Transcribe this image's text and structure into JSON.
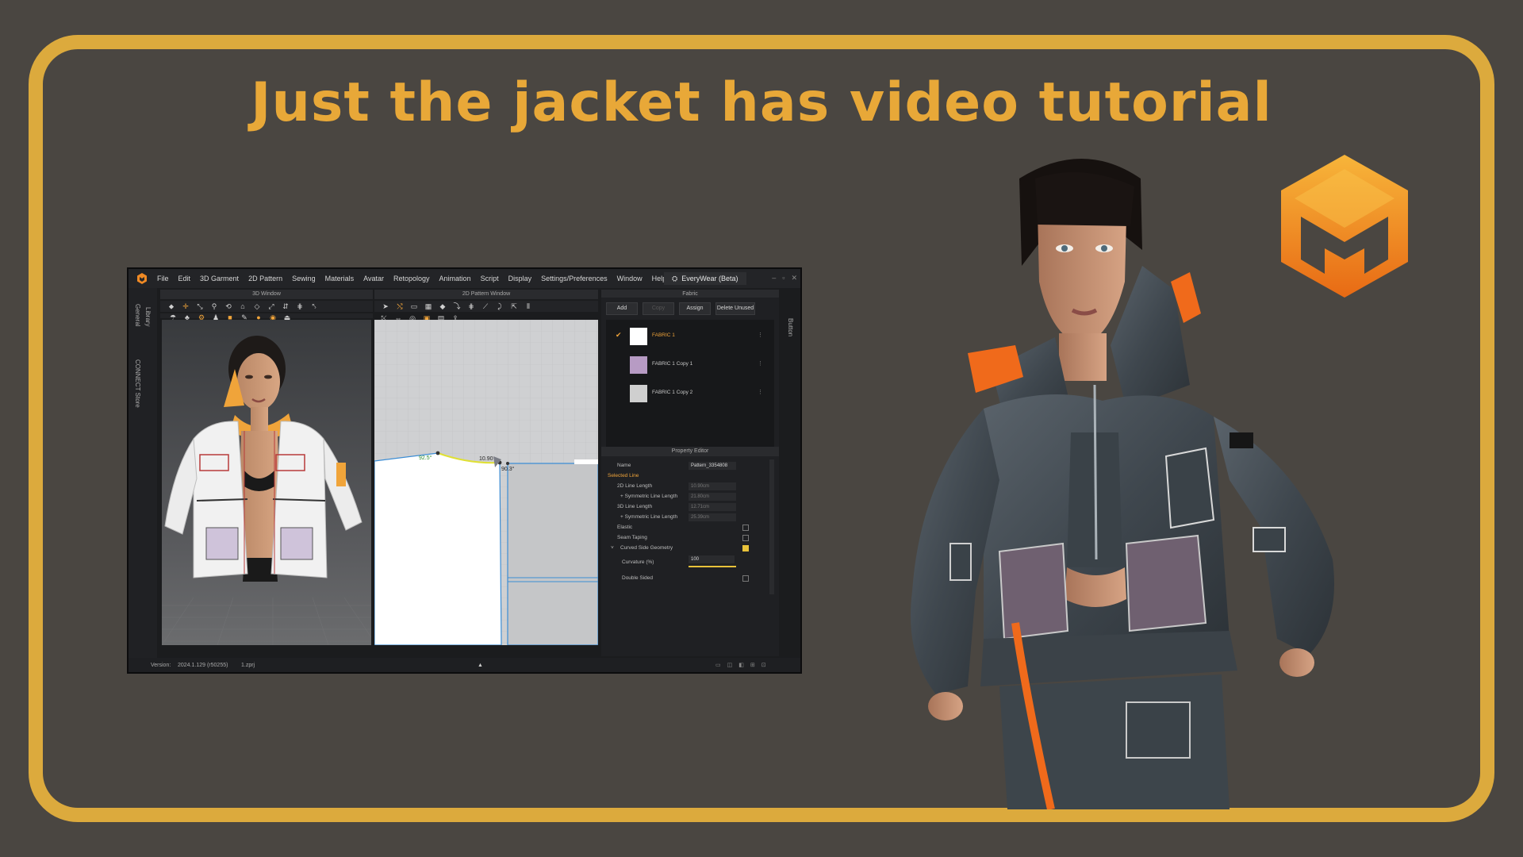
{
  "headline": "Just the jacket has video tutorial",
  "app": {
    "menu": [
      "File",
      "Edit",
      "3D Garment",
      "2D Pattern",
      "Sewing",
      "Materials",
      "Avatar",
      "Retopology",
      "Animation",
      "Script",
      "Display",
      "Settings/Preferences",
      "Window",
      "Help"
    ],
    "workspace": "EveryWear (Beta)",
    "side_tabs": [
      "Library",
      "General",
      "CONNECT Store"
    ],
    "right_tab": "Button",
    "panel_3d_title": "3D Window",
    "panel_2d_title": "2D Pattern Window",
    "fabric_panel_title": "Fabric",
    "fabric_buttons": {
      "add": "Add",
      "copy": "Copy",
      "assign": "Assign",
      "delete_unused": "Delete Unused"
    },
    "fabrics": [
      {
        "name": "FABRIC 1",
        "color": "#ffffff",
        "selected": true
      },
      {
        "name": "FABRIC 1 Copy 1",
        "color": "#b79bc4",
        "selected": false
      },
      {
        "name": "FABRIC 1 Copy 2",
        "color": "#cfcfcf",
        "selected": false
      }
    ],
    "property_editor_title": "Property Editor",
    "properties": {
      "name_label": "Name",
      "name_value": "Pattern_3354808",
      "selected_line": "Selected Line",
      "line_2d_label": "2D Line Length",
      "line_2d_value": "10.90cm",
      "sym_2d_label": "+ Symmetric Line Length",
      "sym_2d_value": "21.80cm",
      "line_3d_label": "3D Line Length",
      "line_3d_value": "12.71cm",
      "sym_3d_label": "+ Symmetric Line Length",
      "sym_3d_value": "25.39cm",
      "elastic_label": "Elastic",
      "seam_taping_label": "Seam Taping",
      "curved_label": "Curved Side Geometry",
      "curvature_label": "Curvature (%)",
      "curvature_value": "100",
      "double_sided_label": "Double Sided"
    },
    "pattern_labels": {
      "angle": "92.5°",
      "length": "10.90",
      "angle2": "90.3°"
    },
    "status": {
      "version_label": "Version:",
      "version_value": "2024.1.129 (r50255)",
      "file": "1.zprj"
    }
  },
  "colors": {
    "accent": "#e8a838",
    "frame": "#dcaa3d",
    "background": "#4a4641"
  }
}
